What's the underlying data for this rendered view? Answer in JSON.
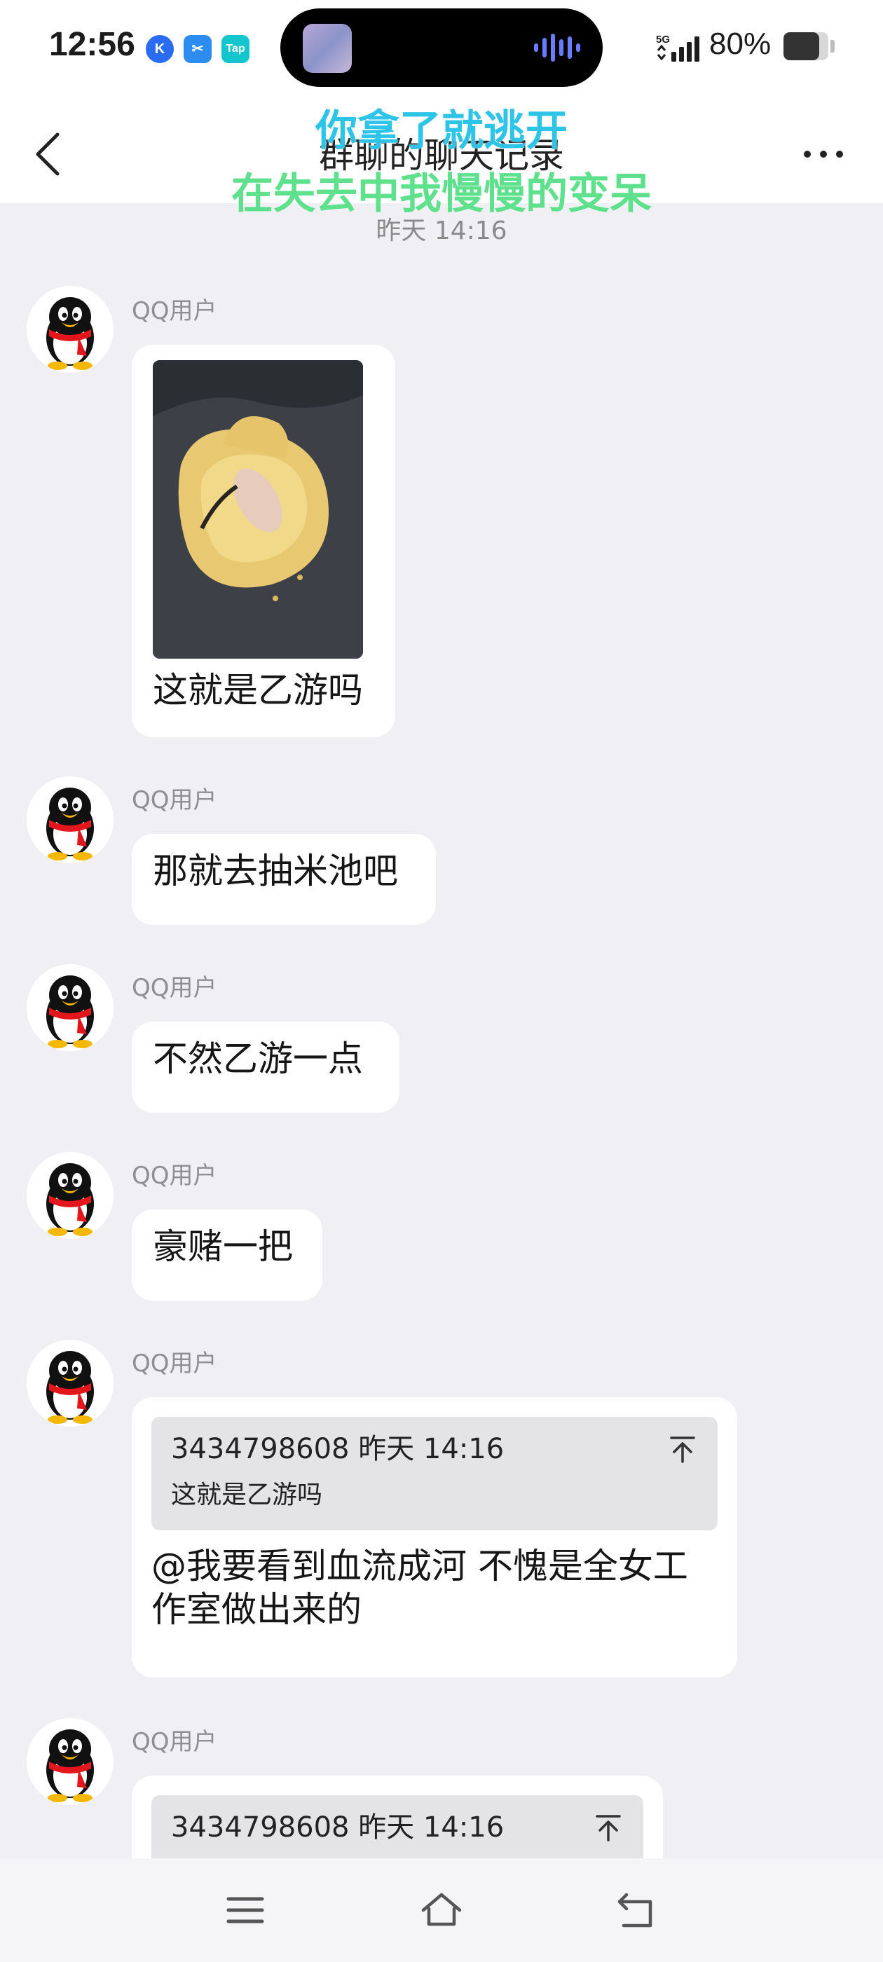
{
  "status_bar": {
    "time": "12:56",
    "app_icons": [
      "K",
      "✂",
      "Tap"
    ],
    "network": "5G",
    "battery_percent": "80%",
    "battery_level": 0.8
  },
  "header": {
    "title": "群聊的聊天记录",
    "back_icon": "chevron-left-icon",
    "more_icon": "more-dots-icon"
  },
  "overlay": {
    "line1": "你拿了就逃开",
    "line2": "在失去中我慢慢的变呆"
  },
  "time_divider": "昨天 14:16",
  "messages": [
    {
      "sender": "QQ用户",
      "text": "这就是乙游吗",
      "has_image": true
    },
    {
      "sender": "QQ用户",
      "text": "那就去抽米池吧"
    },
    {
      "sender": "QQ用户",
      "text": "不然乙游一点"
    },
    {
      "sender": "QQ用户",
      "text": "豪赌一把"
    },
    {
      "sender": "QQ用户",
      "quote": {
        "head": "3434798608 昨天 14:16",
        "text": "这就是乙游吗"
      },
      "text_line1": "@我要看到血流成河 不愧是全女工",
      "text_line2": "作室做出来的"
    },
    {
      "sender": "QQ用户",
      "quote": {
        "head": "3434798608 昨天 14:16"
      }
    }
  ],
  "nav": {
    "menu_icon": "menu-icon",
    "home_icon": "home-icon",
    "back_icon": "back-icon"
  },
  "colors": {
    "background": "#efeff4",
    "overlay_line1": "#2ec4e8",
    "overlay_line2": "#5fe08d",
    "bubble": "#ffffff",
    "quote_bg": "#e4e4e6"
  }
}
